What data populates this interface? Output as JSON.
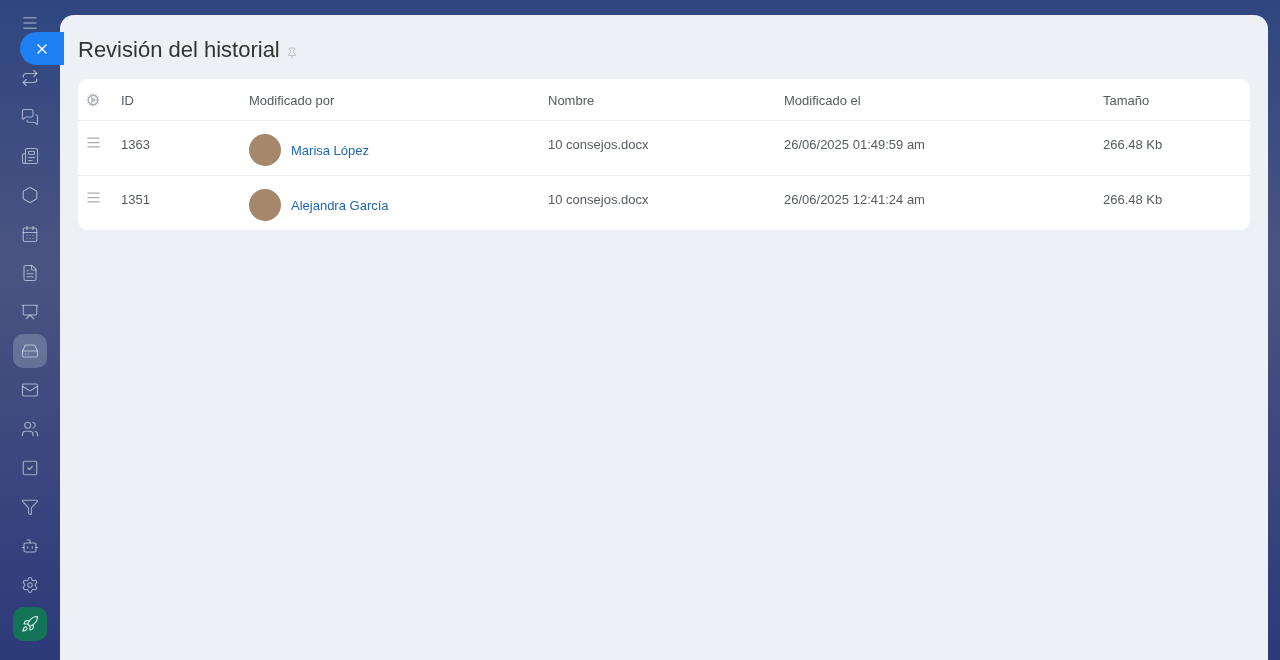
{
  "sidebar": {
    "items": [
      {
        "kind": "repeat",
        "selected": false
      },
      {
        "kind": "chat",
        "selected": false
      },
      {
        "kind": "news",
        "selected": false
      },
      {
        "kind": "hexagon",
        "selected": false
      },
      {
        "kind": "calendar",
        "selected": false
      },
      {
        "kind": "document",
        "selected": false
      },
      {
        "kind": "presentation",
        "selected": false
      },
      {
        "kind": "drive",
        "selected": true
      },
      {
        "kind": "mail",
        "selected": false
      },
      {
        "kind": "users",
        "selected": false
      },
      {
        "kind": "tasks",
        "selected": false
      },
      {
        "kind": "funnel",
        "selected": false
      },
      {
        "kind": "bot",
        "selected": false
      },
      {
        "kind": "settings",
        "selected": false
      },
      {
        "kind": "rocket",
        "selected": false
      }
    ]
  },
  "panel": {
    "title": "Revisión del historial"
  },
  "table": {
    "columns": [
      "ID",
      "Modificado por",
      "Nombre",
      "Modificado el",
      "Tamaño"
    ],
    "rows": [
      {
        "id": "1363",
        "modified_by": "Marisa López",
        "name": "10 consejos.docx",
        "modified_at": "26/06/2025 01:49:59 am",
        "size": "266.48 Kb"
      },
      {
        "id": "1351",
        "modified_by": "Alejandra García",
        "name": "10 consejos.docx",
        "modified_at": "26/06/2025 12:41:24 am",
        "size": "266.48 Kb"
      }
    ]
  }
}
